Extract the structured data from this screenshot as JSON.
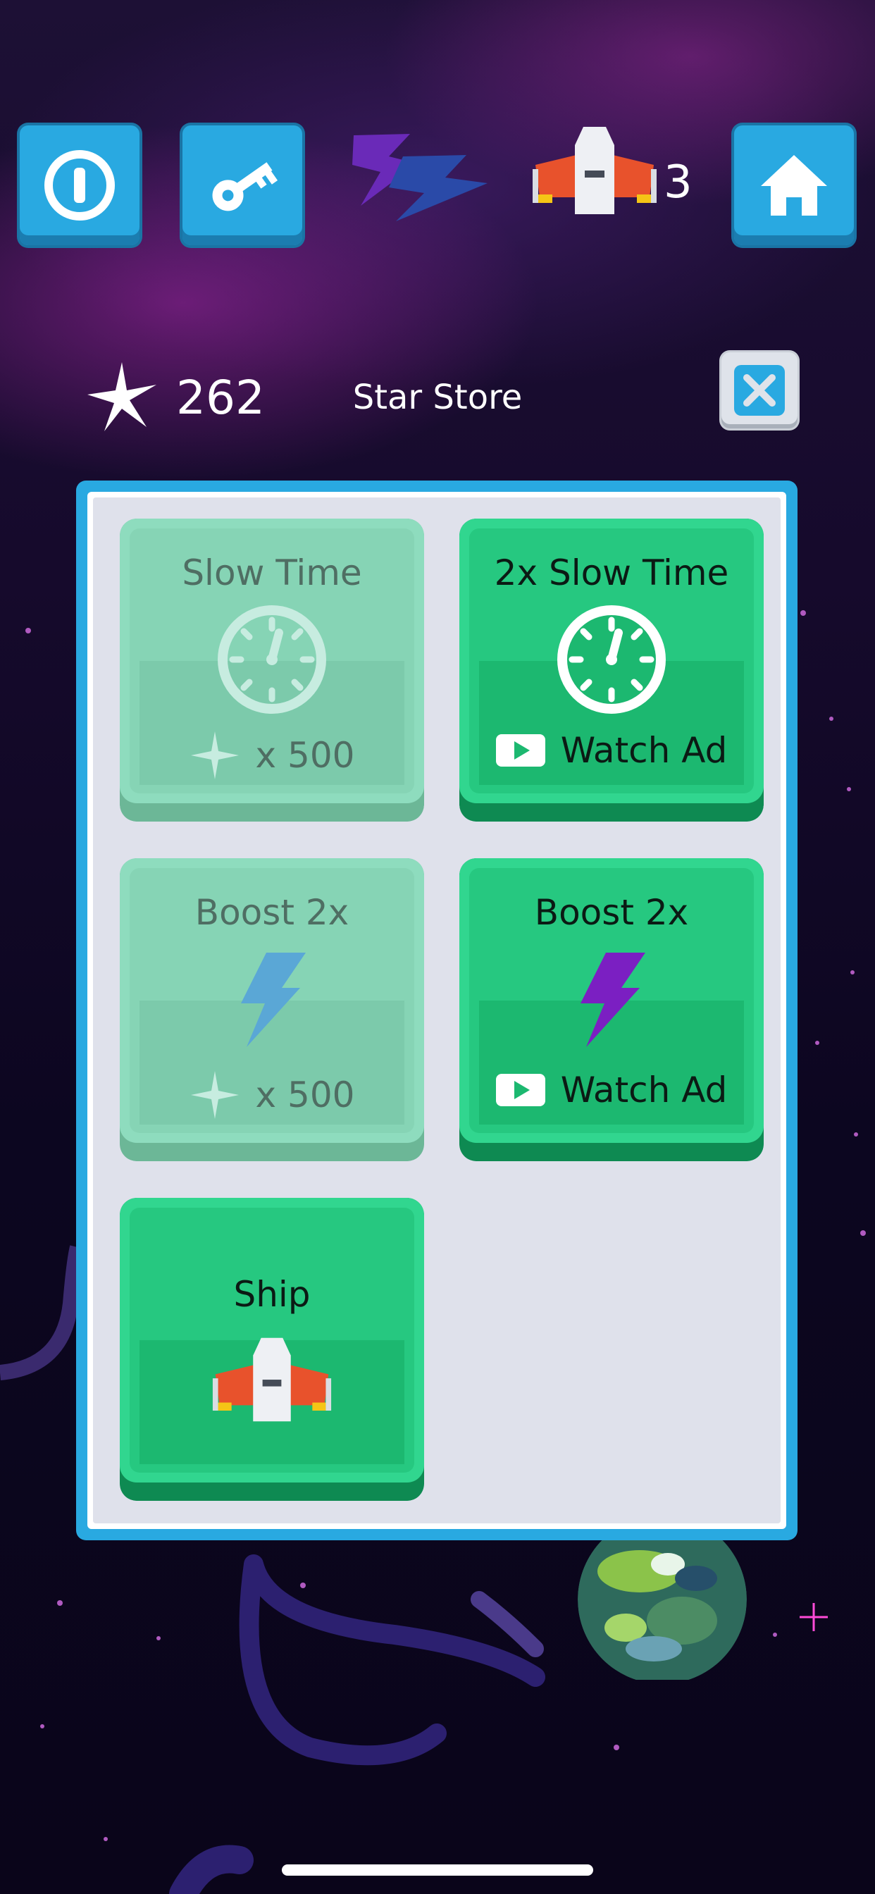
{
  "hud": {
    "lives": "3",
    "stars": "262",
    "store_title": "Star Store"
  },
  "store": {
    "items": [
      {
        "title": "Slow Time",
        "price": "x 500",
        "state": "disabled"
      },
      {
        "title": "2x Slow Time",
        "price": "Watch Ad",
        "state": "active"
      },
      {
        "title": "Boost 2x",
        "price": "x 500",
        "state": "disabled"
      },
      {
        "title": "Boost 2x",
        "price": "Watch Ad",
        "state": "active"
      },
      {
        "title": "Ship",
        "price": "",
        "state": "active"
      }
    ]
  },
  "icons": {
    "pause": "pause-icon",
    "key": "key-icon",
    "boost": "boost-lightning-icon",
    "ship": "ship-icon",
    "home": "home-icon",
    "star": "star-icon",
    "close": "close-icon",
    "clock": "clock-icon",
    "play": "video-play-icon",
    "planet": "planet-icon"
  },
  "colors": {
    "button_blue": "#29a9e1",
    "card_green": "#31d68f",
    "card_green_disabled": "#8edcbe",
    "panel_bg": "#dfe1eb"
  }
}
